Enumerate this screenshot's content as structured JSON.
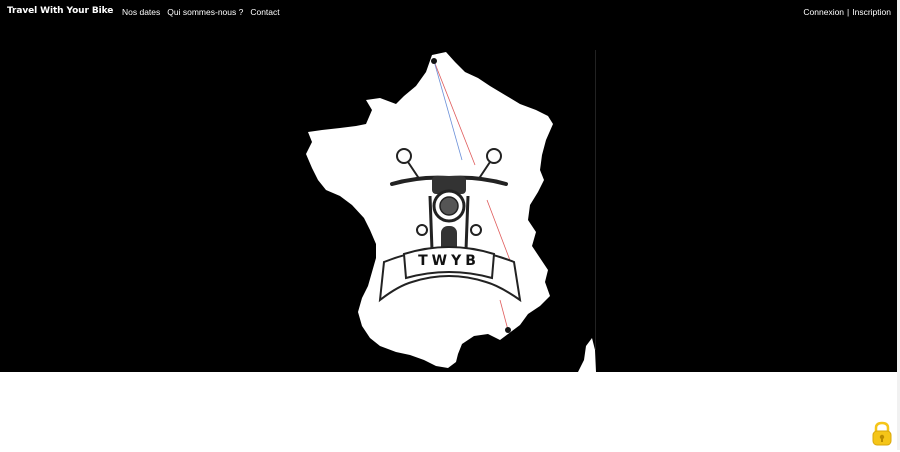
{
  "header": {
    "brand": "Travel With Your Bike",
    "nav": [
      {
        "label": "Nos dates"
      },
      {
        "label": "Qui sommes-nous ?"
      },
      {
        "label": "Contact"
      }
    ],
    "auth": {
      "login": "Connexion",
      "separator": "|",
      "register": "Inscription"
    }
  },
  "hero": {
    "logo_text": "TWYB",
    "map_icon": "france-map-icon",
    "logo_icon": "motorcycle-logo-icon",
    "background_color": "#000000"
  },
  "floating": {
    "lock_icon": "lock-icon",
    "lock_color": "#f5c518"
  }
}
